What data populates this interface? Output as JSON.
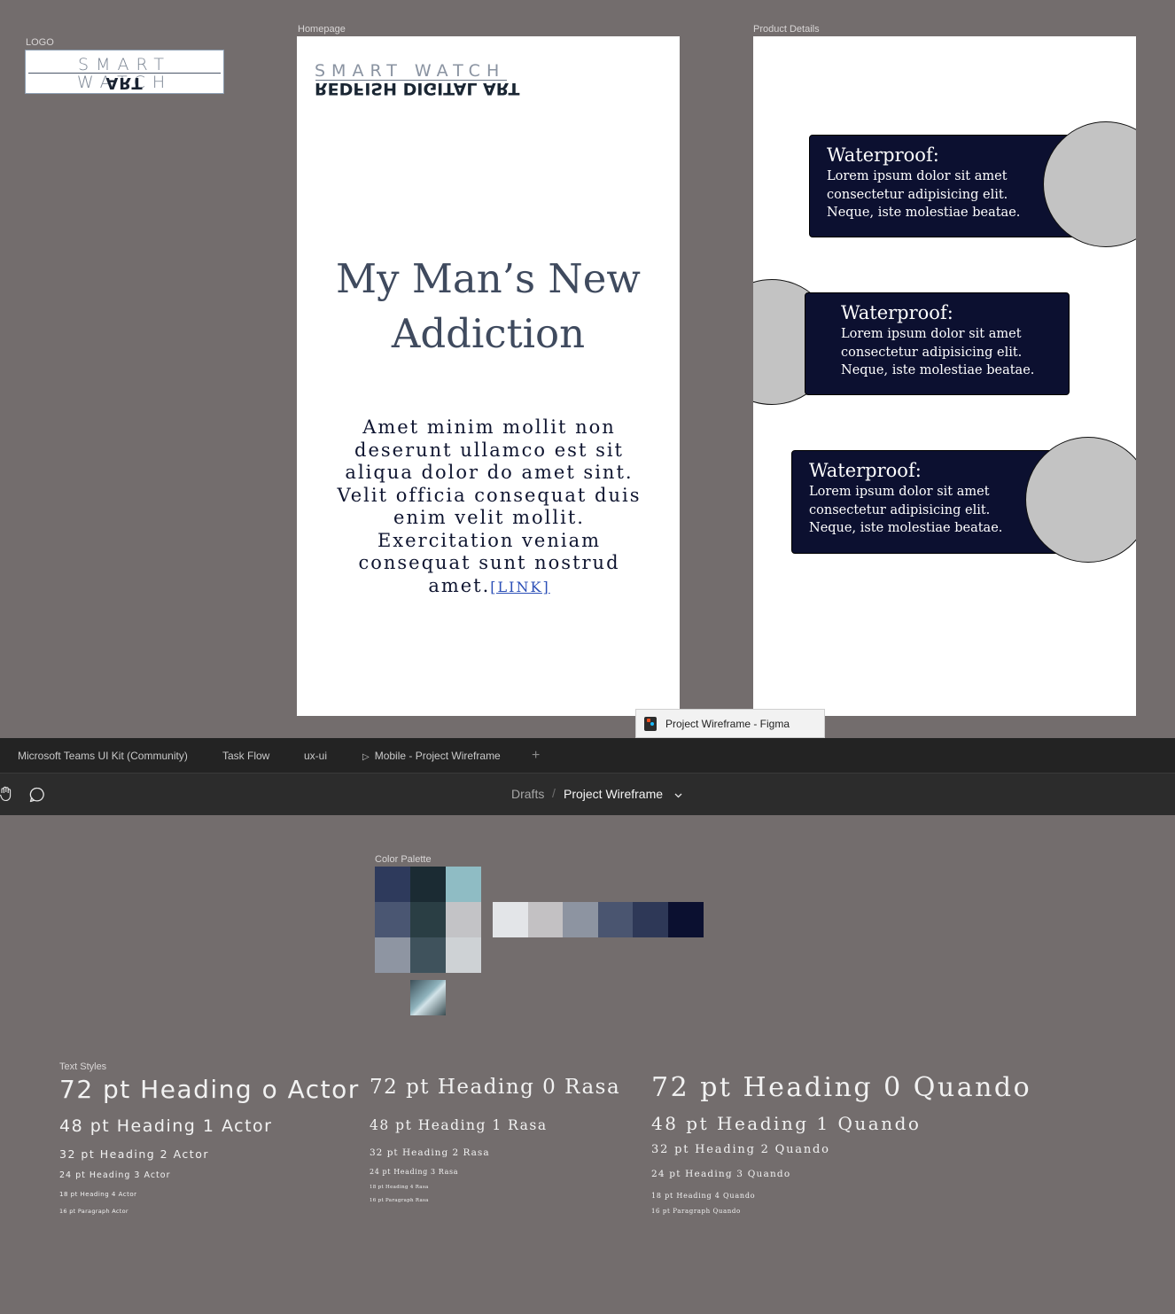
{
  "canvas": {
    "logo_frame_label": "LOGO",
    "homepage_frame_label": "Homepage",
    "product_frame_label": "Product Details",
    "palette_label": "Color Palette",
    "text_styles_label": "Text Styles"
  },
  "logo": {
    "line1": "SMART WATCH",
    "line2": "REDFISH DIGITAL ART"
  },
  "homepage": {
    "logo_line1": "SMART WATCH",
    "logo_line2": "REDFISH DIGITAL ART",
    "title": "My Man’s New Addiction",
    "body": "Amet minim mollit non deserunt ullamco est sit aliqua dolor do amet sint. Velit officia consequat duis enim velit mollit. Exercitation veniam consequat sunt nostrud amet.",
    "link": "[LINK]"
  },
  "product_details": {
    "cards": [
      {
        "title": "Waterproof:",
        "text": "Lorem ipsum dolor sit amet consectetur adipisicing elit. Neque, iste molestiae beatae."
      },
      {
        "title": "Waterproof:",
        "text": "Lorem ipsum dolor sit amet consectetur adipisicing elit. Neque, iste molestiae beatae."
      },
      {
        "title": "Waterproof:",
        "text": "Lorem ipsum dolor sit amet consectetur adipisicing elit. Neque, iste molestiae beatae."
      }
    ]
  },
  "window": {
    "tooltip": "Project Wireframe - Figma",
    "tabs": [
      {
        "label": "Microsoft Teams UI Kit (Community)"
      },
      {
        "label": "Task Flow"
      },
      {
        "label": "ux-ui"
      },
      {
        "label": "Mobile - Project Wireframe"
      }
    ],
    "add_tab": "+",
    "breadcrumb_parent": "Drafts",
    "breadcrumb_sep": "/",
    "file_name": "Project Wireframe"
  },
  "palette": {
    "grid": [
      "#2e3a5c",
      "#1b2b33",
      "#8fbcc4",
      "#4a5672",
      "#2a3e44",
      "#c3c3c6",
      "#8e95a2",
      "#3f525c",
      "#ced2d5"
    ],
    "row": [
      "#e3e5e8",
      "#c3c1c3",
      "#8d94a1",
      "#4a5570",
      "#2e3857",
      "#0b1030"
    ]
  },
  "text_styles": {
    "actor": [
      "72 pt Heading o Actor",
      "48 pt Heading 1 Actor",
      "32 pt Heading 2 Actor",
      "24 pt Heading 3 Actor",
      "18 pt Heading 4 Actor",
      "16 pt Paragraph Actor"
    ],
    "rasa": [
      "72 pt Heading 0 Rasa",
      "48 pt Heading 1 Rasa",
      "32 pt Heading 2 Rasa",
      "24 pt Heading 3 Rasa",
      "18 pt Heading 4 Rasa",
      "16 pt Paragraph Rasa"
    ],
    "quando": [
      "72 pt Heading 0 Quando",
      "48 pt Heading 1 Quando",
      "32 pt Heading 2 Quando",
      "24 pt Heading 3 Quando",
      "18 pt Heading 4 Quando",
      "16 pt Paragraph Quando"
    ]
  }
}
